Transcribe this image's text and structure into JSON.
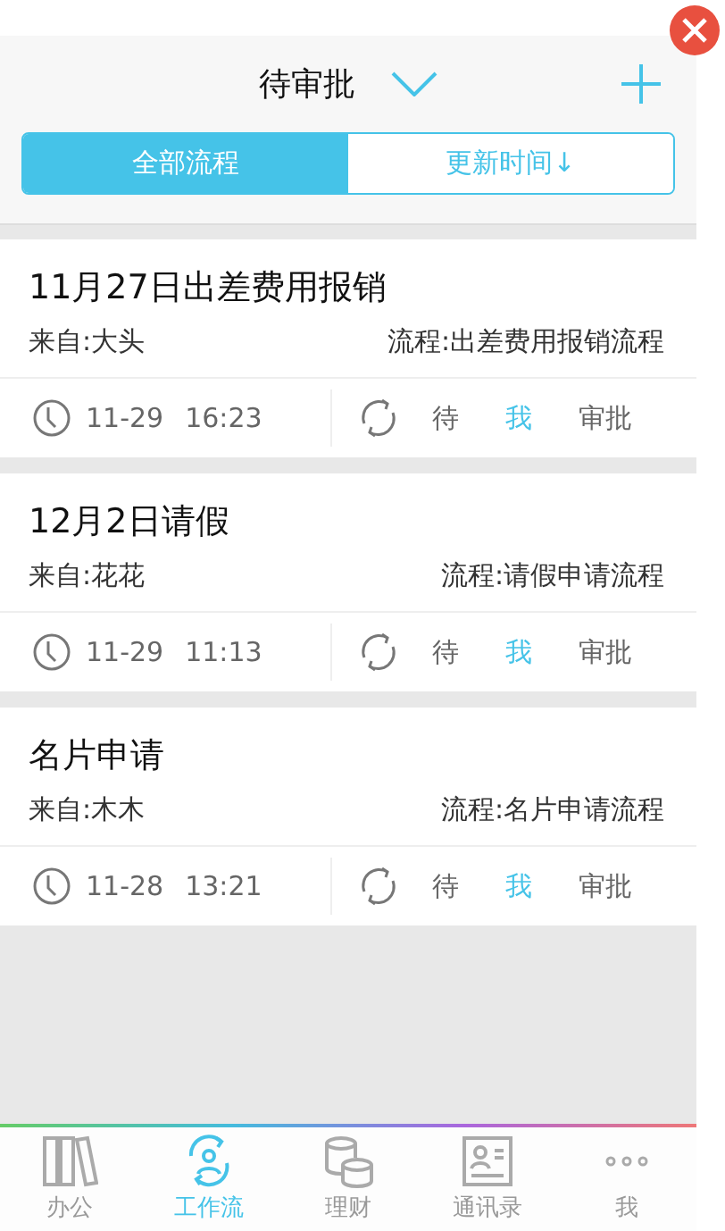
{
  "header": {
    "title": "待审批"
  },
  "segments": [
    {
      "label": "全部流程",
      "selected": true
    },
    {
      "label": "更新时间↓",
      "selected": false
    }
  ],
  "items": [
    {
      "title": "11月27日出差费用报销",
      "from": "来自:大头",
      "process": "流程:出差费用报销流程",
      "date": "11-29",
      "time": "16:23",
      "steps": [
        {
          "label": "待",
          "current": false
        },
        {
          "label": "我",
          "current": true
        },
        {
          "label": "审批",
          "current": false
        }
      ]
    },
    {
      "title": "12月2日请假",
      "from": "来自:花花",
      "process": "流程:请假申请流程",
      "date": "11-29",
      "time": "11:13",
      "steps": [
        {
          "label": "待",
          "current": false
        },
        {
          "label": "我",
          "current": true
        },
        {
          "label": "审批",
          "current": false
        }
      ]
    },
    {
      "title": "名片申请",
      "from": "来自:木木",
      "process": "流程:名片申请流程",
      "date": "11-28",
      "time": "13:21",
      "steps": [
        {
          "label": "待",
          "current": false
        },
        {
          "label": "我",
          "current": true
        },
        {
          "label": "审批",
          "current": false
        }
      ]
    }
  ],
  "tabs": [
    {
      "label": "办公",
      "kind": "books",
      "selected": false
    },
    {
      "label": "工作流",
      "kind": "flow",
      "selected": true
    },
    {
      "label": "理财",
      "kind": "coins",
      "selected": false
    },
    {
      "label": "通讯录",
      "kind": "contacts",
      "selected": false
    },
    {
      "label": "我",
      "kind": "more",
      "selected": false
    }
  ]
}
